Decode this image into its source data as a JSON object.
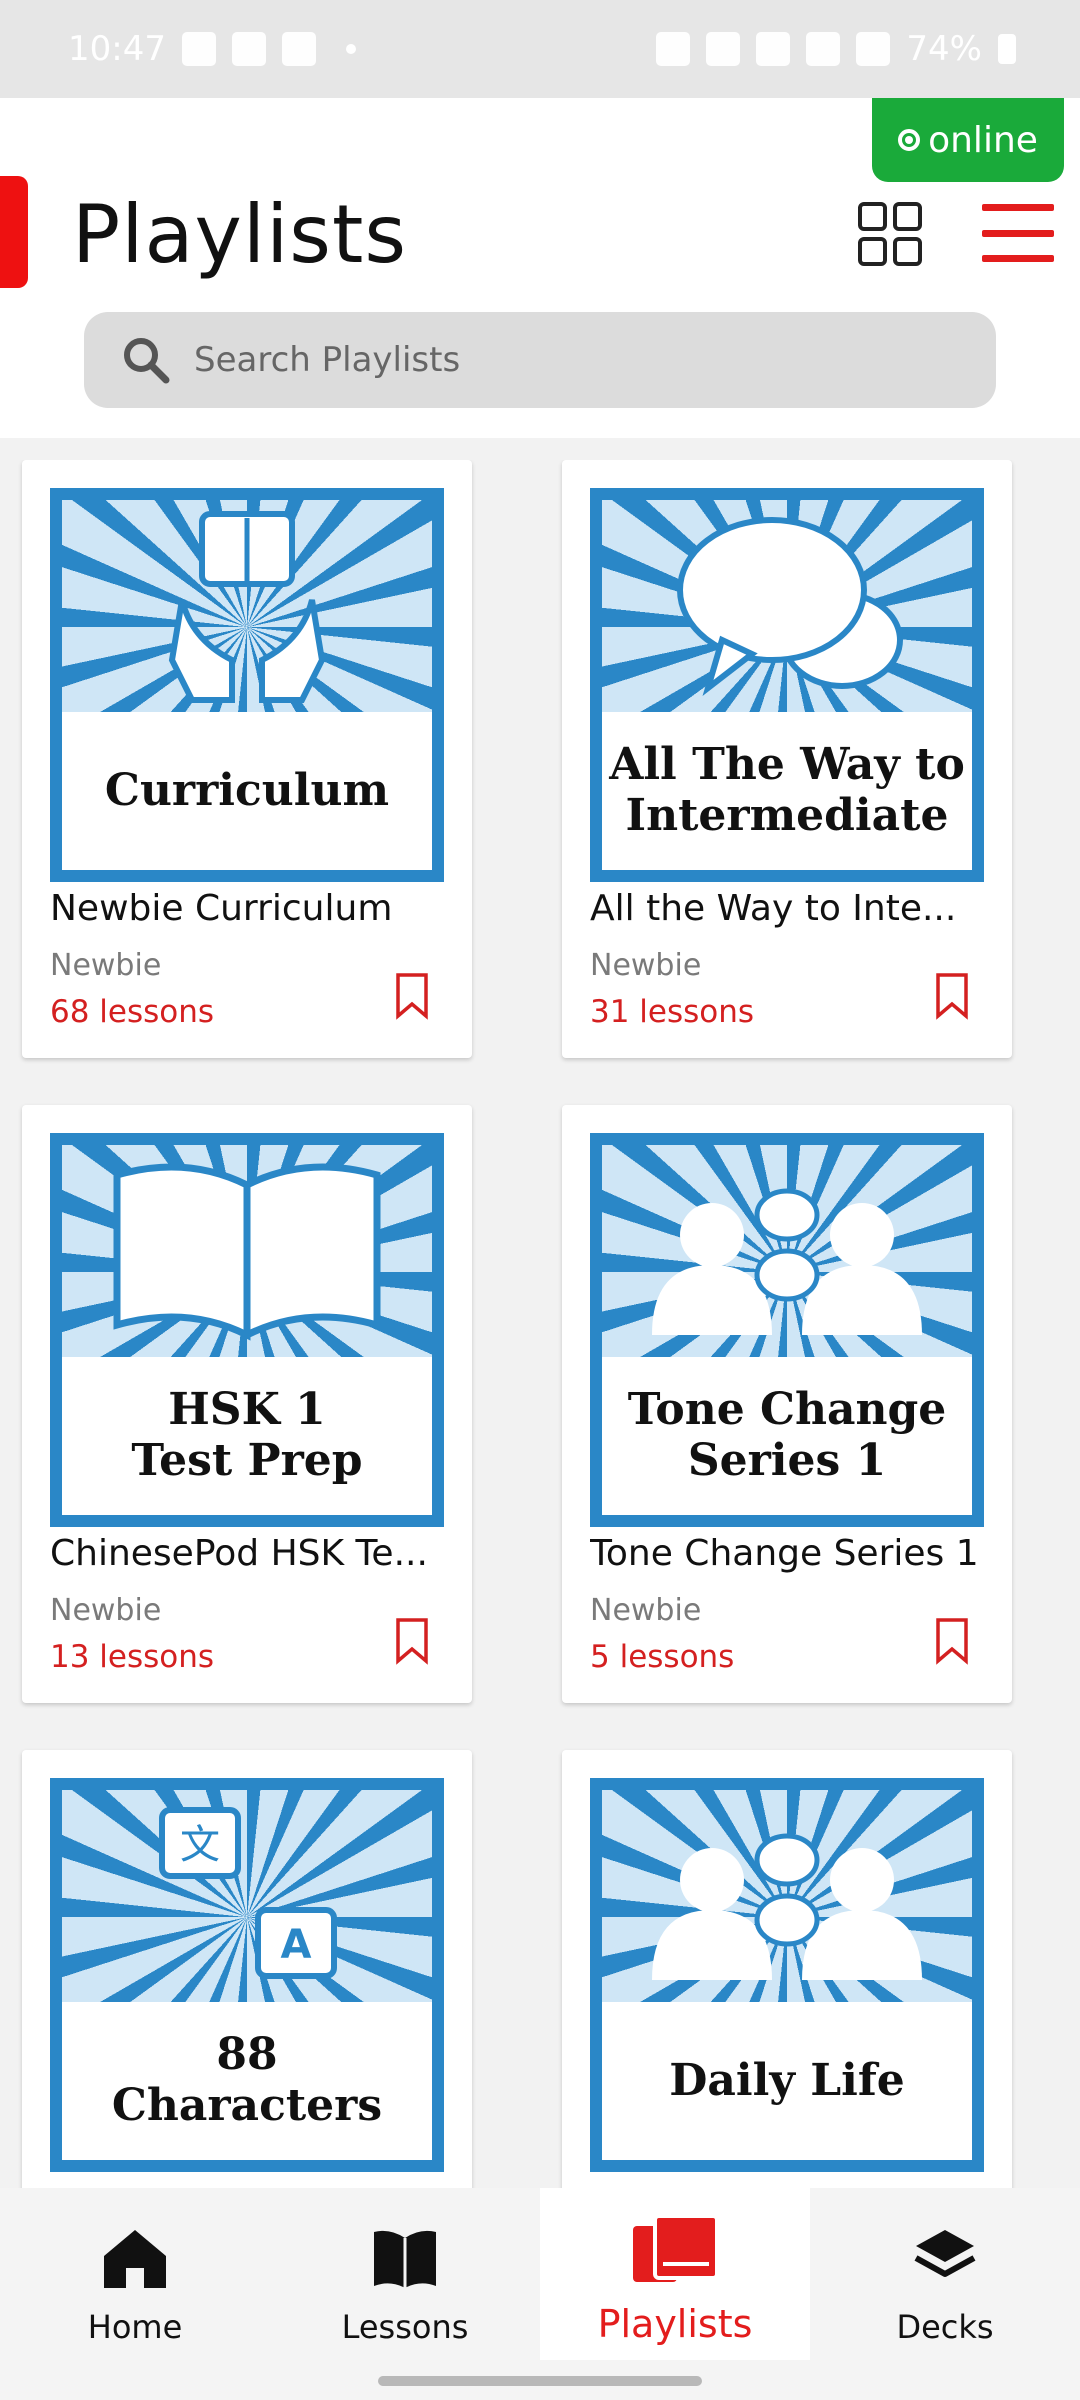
{
  "status_bar": {
    "time": "10:47",
    "battery": "74%"
  },
  "header": {
    "online_label": "online",
    "title": "Playlists",
    "search_placeholder": "Search Playlists"
  },
  "playlists": [
    {
      "thumb_text": "Curriculum",
      "art": "hands-book",
      "title": "Newbie Curriculum",
      "level": "Newbie",
      "lessons": "68 lessons"
    },
    {
      "thumb_text": "All The Way to\nIntermediate",
      "art": "speech-bubbles",
      "title": "All the Way to Inte...",
      "level": "Newbie",
      "lessons": "31 lessons"
    },
    {
      "thumb_text": "HSK 1\nTest Prep",
      "art": "open-book",
      "title": "ChinesePod HSK Te...",
      "level": "Newbie",
      "lessons": "13 lessons"
    },
    {
      "thumb_text": "Tone Change\nSeries 1",
      "art": "two-people-talking",
      "title": "Tone Change Series 1",
      "level": "Newbie",
      "lessons": "5 lessons"
    },
    {
      "thumb_text": "88\nCharacters",
      "art": "translate",
      "title": "",
      "level": "",
      "lessons": ""
    },
    {
      "thumb_text": "Daily Life",
      "art": "two-people-chat",
      "title": "",
      "level": "",
      "lessons": ""
    }
  ],
  "bottom_nav": {
    "items": [
      {
        "label": "Home",
        "icon": "home-icon"
      },
      {
        "label": "Lessons",
        "icon": "book-icon"
      },
      {
        "label": "Playlists",
        "icon": "playlists-icon",
        "active": true
      },
      {
        "label": "Decks",
        "icon": "layers-icon"
      }
    ]
  },
  "colors": {
    "accent": "#e31d1d",
    "online": "#1aaa3a",
    "thumb_blue": "#2a87c7"
  }
}
